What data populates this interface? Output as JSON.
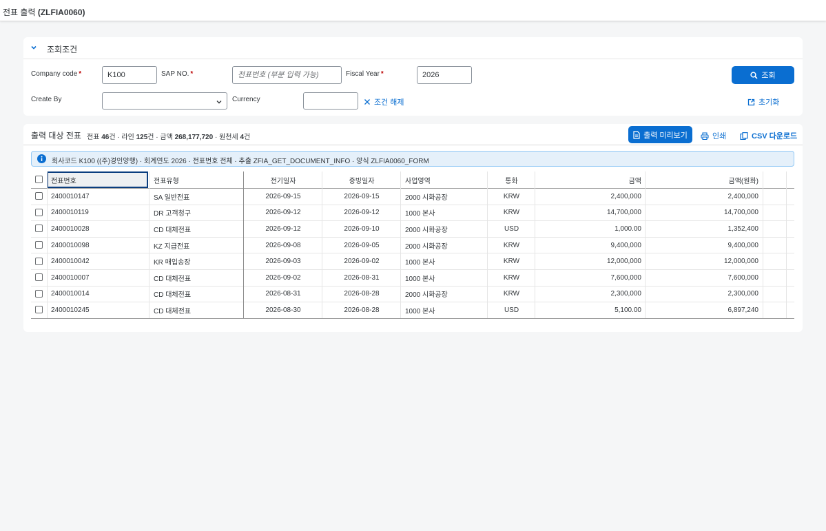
{
  "page": {
    "title_prefix": "전표 출력",
    "title_code": "(ZLFIA0060)"
  },
  "filter": {
    "title": "조회조건",
    "company_code_label": "Company code",
    "company_code_value": "K100",
    "sap_no_label": "SAP NO.",
    "sap_no_placeholder": "전표번호 (부분 입력 가능)",
    "fiscal_year_label": "Fiscal Year",
    "fiscal_year_value": "2026",
    "create_by_label": "Create By",
    "create_by_value": "",
    "currency_label": "Currency",
    "currency_value": "",
    "clear_label": "조건 해제",
    "search_label": "조회",
    "reset_label": "초기화",
    "required_mark": "*"
  },
  "results": {
    "title": "출력 대상 전표",
    "summary": {
      "doc_label": "전표",
      "doc_count": "46",
      "doc_unit": "건 · 라인",
      "line_count": "125",
      "line_unit": "건 · 금액",
      "amount": "268,177,720",
      "wht_label": "· 원천세",
      "wht_count": "4",
      "wht_unit": "건"
    },
    "preview_label": "출력 미리보기",
    "print_label": "인쇄",
    "csv_label": "CSV 다운로드",
    "info_text": "회사코드 K100 ((주)경인양행) · 회계연도 2026 · 전표번호 전체 · 추출 ZFIA_GET_DOCUMENT_INFO · 양식 ZLFIA0060_FORM"
  },
  "table": {
    "columns": [
      "전표번호",
      "전표유형",
      "전기일자",
      "증빙일자",
      "사업영역",
      "통화",
      "금액",
      "금액(원화)"
    ],
    "rows": [
      [
        "2400010147",
        "SA 일반전표",
        "2026-09-15",
        "2026-09-15",
        "2000 시화공장",
        "KRW",
        "2,400,000",
        "2,400,000"
      ],
      [
        "2400010119",
        "DR 고객청구",
        "2026-09-12",
        "2026-09-12",
        "1000 본사",
        "KRW",
        "14,700,000",
        "14,700,000"
      ],
      [
        "2400010028",
        "CD 대체전표",
        "2026-09-12",
        "2026-09-10",
        "2000 시화공장",
        "USD",
        "1,000.00",
        "1,352,400"
      ],
      [
        "2400010098",
        "KZ 지급전표",
        "2026-09-08",
        "2026-09-05",
        "2000 시화공장",
        "KRW",
        "9,400,000",
        "9,400,000"
      ],
      [
        "2400010042",
        "KR 매입송장",
        "2026-09-03",
        "2026-09-02",
        "1000 본사",
        "KRW",
        "12,000,000",
        "12,000,000"
      ],
      [
        "2400010007",
        "CD 대체전표",
        "2026-09-02",
        "2026-08-31",
        "1000 본사",
        "KRW",
        "7,600,000",
        "7,600,000"
      ],
      [
        "2400010014",
        "CD 대체전표",
        "2026-08-31",
        "2026-08-28",
        "2000 시화공장",
        "KRW",
        "2,300,000",
        "2,300,000"
      ],
      [
        "2400010245",
        "CD 대체전표",
        "2026-08-30",
        "2026-08-28",
        "1000 본사",
        "USD",
        "5,100.00",
        "6,897,240"
      ]
    ]
  },
  "colors": {
    "accent": "#0a6ed1",
    "required": "#bb0000",
    "info_bg": "#e5f0fa"
  }
}
